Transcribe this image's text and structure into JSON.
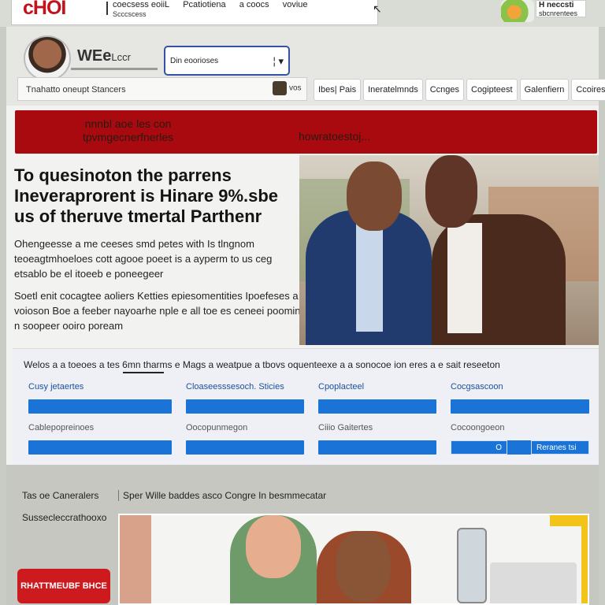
{
  "topbar": {
    "logo": "cHOI",
    "links": [
      "coecsess eoiiL",
      "Pcatiotiena",
      "a coocs",
      "voviue"
    ],
    "subtitle": "Scccscess",
    "right_title": "H neccsti",
    "right_sub": "sbcnrentees"
  },
  "header": {
    "brand": "WEe",
    "brand_small": "Lccr",
    "select_value": "Din eoorioses",
    "search_label": "Tnahatto oneupt Stancers",
    "search_button": "vos",
    "nav": [
      "Ibes| Pais",
      "Ineratelmnds",
      "Ccnges",
      "Cogipteest",
      "Galenfiern",
      "Ccoires"
    ]
  },
  "banner": {
    "left_line1": "nnnbl aoe les con",
    "left_line2": "tpvmgecnerfnerles",
    "right": "howratoestoj..."
  },
  "hero": {
    "title_lines": [
      "To quesinoton the parrens",
      "Ineveraprorent is Hinare 9%.sbe",
      "us of theruve tmertal Parthenr"
    ],
    "paragraph1": "Ohengeesse a me ceeses smd petes with Is tlngnom teoeagtmhoeloes cott agooe poeet is a ayperm to us ceg etsablo be el itoeeb e poneegeer",
    "paragraph2": "Soetl enit cocagtee aoliers Ketties epiesomentities Ipoefeses a voioson Boe a feeber nayoarhe nple e all toe es ceneei poomin n soopeer ooiro poream"
  },
  "form": {
    "intro": "Welos a a toeoes a tes 6mn tharms e Mags a weatpue a tbovs oquenteexe a a sonocoe ion eres a e sait reseeton",
    "columns": [
      {
        "label": "Cusy jetaertes",
        "label2": "Cablepopreinoes"
      },
      {
        "label": "Cloaseesssesoch. Sticies",
        "label2": "Oocopunmegon"
      },
      {
        "label": "Cpoplacteel",
        "label2": "Ciiio Gaitertes"
      },
      {
        "label": "Cocgsascoon",
        "label2": "Cocoongoeon"
      }
    ],
    "button_a": "O",
    "button_b": "Reranes tsi"
  },
  "bottom": {
    "left_1": "Tas oe Caneralers",
    "tagline": "Sper Wille baddes asco Congre In besmmecatar",
    "left_2": "Sussecleccrathooxo",
    "cta": "RHATTMEUBF BHCE"
  },
  "colors": {
    "brand_red": "#c4121c",
    "banner_red": "#a90a10",
    "accent_blue": "#1a73d6",
    "select_border": "#3553a6",
    "cta_red": "#cc1a1e"
  }
}
